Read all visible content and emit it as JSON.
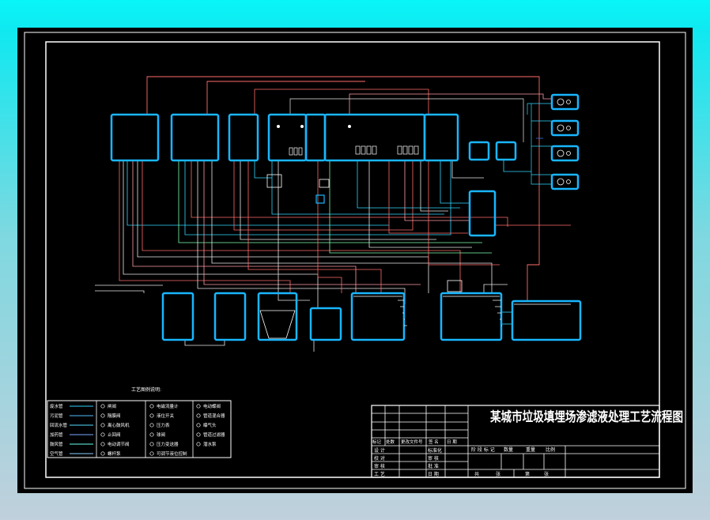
{
  "drawing": {
    "title": "某城市垃圾填埋场渗滤液处理工艺流程图",
    "legend_heading": "工艺图例说明:",
    "legend_lines": [
      {
        "label": "废水管",
        "color": "#33ccff"
      },
      {
        "label": "污泥管",
        "color": "#55bbff"
      },
      {
        "label": "回流水管",
        "color": "#55ddff"
      },
      {
        "label": "加药管",
        "color": "#77aaff"
      },
      {
        "label": "鼓风管",
        "color": "#66ffee"
      },
      {
        "label": "空气管",
        "color": "#88ccff"
      }
    ],
    "legend_symbols_col1": [
      "闸阀 ",
      "隔膜阀",
      "离心鼓风机",
      "止回阀",
      "电动调节阀",
      "螺杆泵"
    ],
    "legend_symbols_col2": [
      "电磁流量计",
      "液位开关",
      "压力表",
      "球阀",
      "压力变送器",
      "可调节液位控制"
    ],
    "legend_symbols_col3": [
      "电动蝶阀",
      "管道混合器",
      "曝气头",
      "管道过滤器",
      "潜水泵"
    ],
    "titleblock": {
      "rev_row": [
        "标记",
        "处数",
        "更改文件号",
        "签 名",
        "日 期"
      ],
      "left_rows": [
        [
          "设 计",
          "",
          "标准化"
        ],
        [
          "校 对",
          "",
          "审 核"
        ],
        [
          "审 核",
          "",
          "批 准"
        ],
        [
          "工 艺",
          "",
          "日 期"
        ]
      ],
      "stage_row": [
        "阶 段 标 记",
        "数量",
        "重量",
        "比例"
      ],
      "sheet_row": [
        "共",
        "张",
        "第",
        "张"
      ]
    }
  }
}
